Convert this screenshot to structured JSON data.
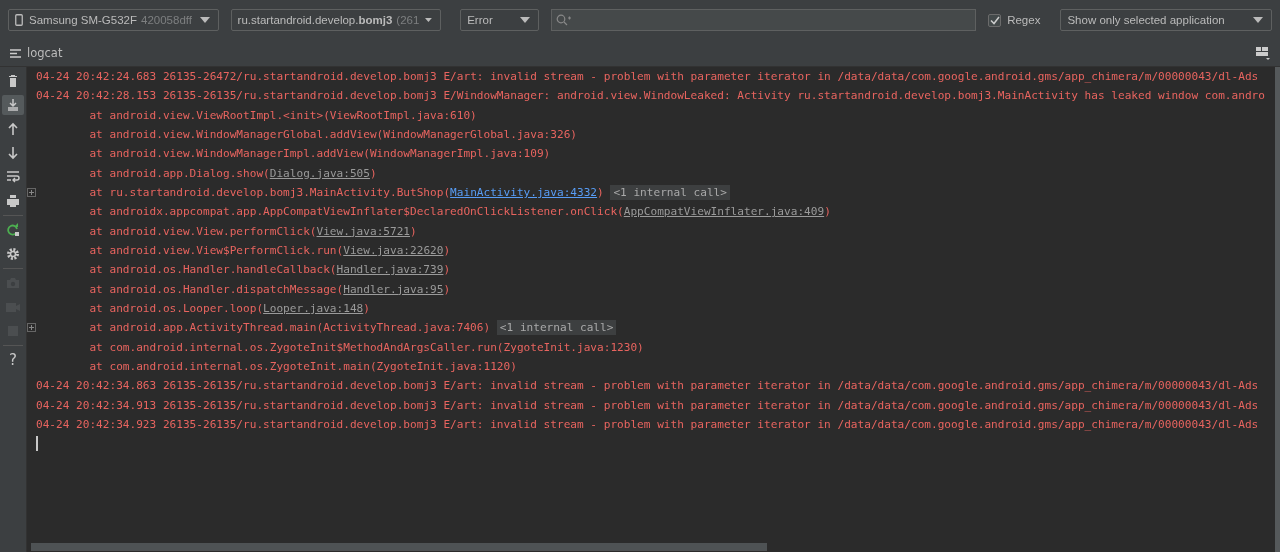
{
  "toolbar": {
    "device": {
      "name": "Samsung SM-G532F",
      "serial": "420058dff"
    },
    "process": {
      "name": "ru.startandroid.develop.**bomj3**",
      "pid": "(261"
    },
    "level": {
      "value": "Error"
    },
    "regex": {
      "label": "Regex",
      "checked": true
    },
    "filter": {
      "value": "Show only selected application"
    }
  },
  "panel": {
    "title": "logcat"
  },
  "side_tools": [
    {
      "kind": "trash",
      "on": false,
      "disabled": false
    },
    {
      "kind": "scroll-end",
      "on": true,
      "disabled": false
    },
    {
      "kind": "up",
      "on": false,
      "disabled": false
    },
    {
      "kind": "down",
      "on": false,
      "disabled": false
    },
    {
      "kind": "wrap",
      "on": false,
      "disabled": false
    },
    {
      "kind": "print",
      "on": false,
      "disabled": false,
      "divider": true
    },
    {
      "kind": "restart",
      "on": false,
      "disabled": false
    },
    {
      "kind": "settings",
      "on": false,
      "disabled": false,
      "divider": true
    },
    {
      "kind": "camera",
      "on": false,
      "disabled": true
    },
    {
      "kind": "video",
      "on": false,
      "disabled": true
    },
    {
      "kind": "stop",
      "on": false,
      "disabled": true,
      "divider": true
    },
    {
      "kind": "help",
      "on": false,
      "disabled": false,
      "label": "?"
    }
  ],
  "log": [
    {
      "kind": "header",
      "text": "04-24 20:42:24.683 26135-26472/ru.startandroid.develop.bomj3 E/art: invalid stream - problem with parameter iterator in /data/data/com.google.android.gms/app_chimera/m/00000043/dl-Ads",
      "foldable": false
    },
    {
      "kind": "header",
      "text": "04-24 20:42:28.153 26135-26135/ru.startandroid.develop.bomj3 E/WindowManager: android.view.WindowLeaked: Activity ru.startandroid.develop.bomj3.MainActivity has leaked window com.andro",
      "foldable": false
    },
    {
      "kind": "trace",
      "text": "at android.view.ViewRootImpl.<init>(ViewRootImpl.java:610)",
      "foldable": false
    },
    {
      "kind": "trace",
      "text": "at android.view.WindowManagerGlobal.addView(WindowManagerGlobal.java:326)",
      "foldable": false
    },
    {
      "kind": "trace",
      "text": "at android.view.WindowManagerImpl.addView(WindowManagerImpl.java:109)",
      "foldable": false
    },
    {
      "kind": "trace",
      "text": "at android.app.Dialog.show(",
      "link": "Dialog.java:505",
      "in_project": false,
      "after": ")",
      "foldable": false
    },
    {
      "kind": "trace",
      "text": "at ru.startandroid.develop.bomj3.MainActivity.ButShop(",
      "link": "MainActivity.java:4332",
      "in_project": true,
      "after": ")",
      "badge": "<1 internal call>",
      "foldable": true
    },
    {
      "kind": "trace",
      "text": "at androidx.appcompat.app.AppCompatViewInflater$DeclaredOnClickListener.onClick(",
      "link": "AppCompatViewInflater.java:409",
      "in_project": false,
      "after": ")",
      "foldable": false
    },
    {
      "kind": "trace",
      "text": "at android.view.View.performClick(",
      "link": "View.java:5721",
      "in_project": false,
      "after": ")",
      "foldable": false
    },
    {
      "kind": "trace",
      "text": "at android.view.View$PerformClick.run(",
      "link": "View.java:22620",
      "in_project": false,
      "after": ")",
      "foldable": false
    },
    {
      "kind": "trace",
      "text": "at android.os.Handler.handleCallback(",
      "link": "Handler.java:739",
      "in_project": false,
      "after": ")",
      "foldable": false
    },
    {
      "kind": "trace",
      "text": "at android.os.Handler.dispatchMessage(",
      "link": "Handler.java:95",
      "in_project": false,
      "after": ")",
      "foldable": false
    },
    {
      "kind": "trace",
      "text": "at android.os.Looper.loop(",
      "link": "Looper.java:148",
      "in_project": false,
      "after": ")",
      "foldable": false
    },
    {
      "kind": "trace",
      "text": "at android.app.ActivityThread.main(ActivityThread.java:7406)",
      "badge": "<1 internal call>",
      "foldable": true
    },
    {
      "kind": "trace",
      "text": "at com.android.internal.os.ZygoteInit$MethodAndArgsCaller.run(ZygoteInit.java:1230)",
      "foldable": false
    },
    {
      "kind": "trace",
      "text": "at com.android.internal.os.ZygoteInit.main(ZygoteInit.java:1120)",
      "foldable": false
    },
    {
      "kind": "header",
      "text": "04-24 20:42:34.863 26135-26135/ru.startandroid.develop.bomj3 E/art: invalid stream - problem with parameter iterator in /data/data/com.google.android.gms/app_chimera/m/00000043/dl-Ads",
      "foldable": false
    },
    {
      "kind": "header",
      "text": "04-24 20:42:34.913 26135-26135/ru.startandroid.develop.bomj3 E/art: invalid stream - problem with parameter iterator in /data/data/com.google.android.gms/app_chimera/m/00000043/dl-Ads",
      "foldable": false
    },
    {
      "kind": "header",
      "text": "04-24 20:42:34.923 26135-26135/ru.startandroid.develop.bomj3 E/art: invalid stream - problem with parameter iterator in /data/data/com.google.android.gms/app_chimera/m/00000043/dl-Ads",
      "foldable": false
    }
  ]
}
